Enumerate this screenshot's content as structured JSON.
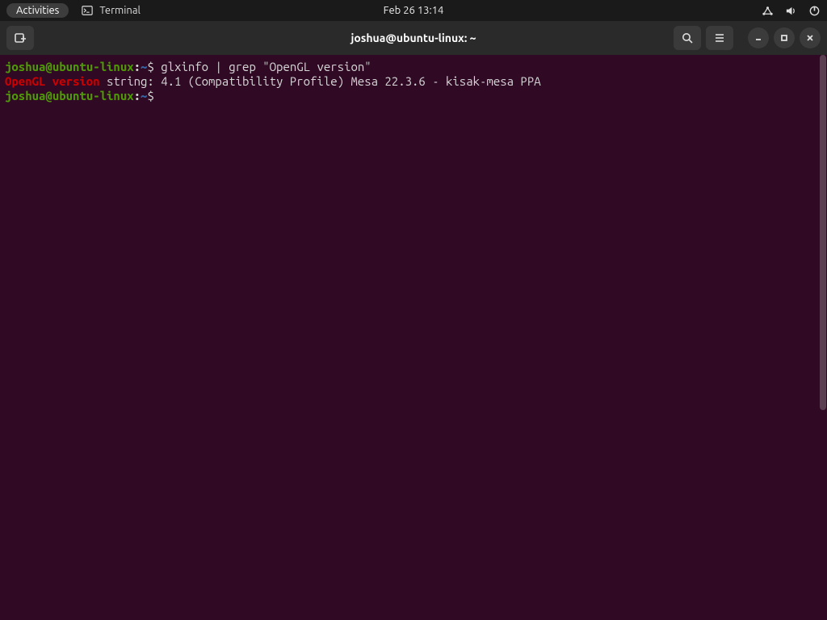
{
  "panel": {
    "activities": "Activities",
    "app_name": "Terminal",
    "datetime": "Feb 26  13:14"
  },
  "titlebar": {
    "title": "joshua@ubuntu-linux: ~"
  },
  "terminal": {
    "lines": [
      {
        "prompt": {
          "user": "joshua",
          "at": "@",
          "host": "ubuntu-linux",
          "colon": ":",
          "path": "~",
          "sigil": "$"
        },
        "command": " glxinfo | grep \"OpenGL version\""
      },
      {
        "output": {
          "match": "OpenGL version",
          "rest": " string: 4.1 (Compatibility Profile) Mesa 22.3.6 - kisak-mesa PPA"
        }
      },
      {
        "prompt": {
          "user": "joshua",
          "at": "@",
          "host": "ubuntu-linux",
          "colon": ":",
          "path": "~",
          "sigil": "$"
        },
        "command": " "
      }
    ]
  }
}
